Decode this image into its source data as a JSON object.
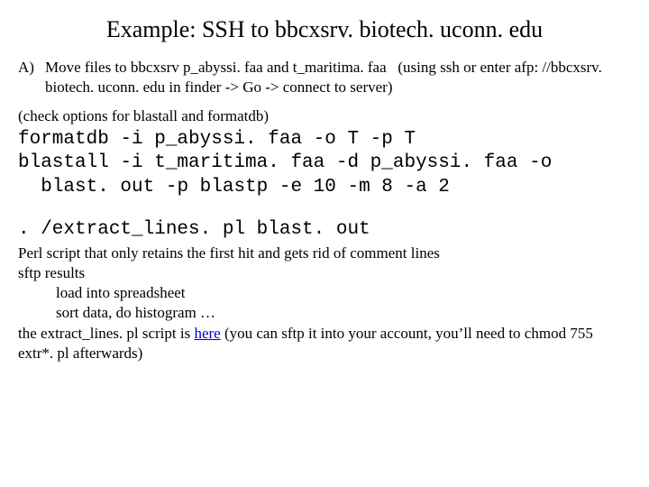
{
  "title": "Example: SSH to bbcxsrv. biotech. uconn. edu",
  "stepA": {
    "label": "A)",
    "text": "Move files to bbcxsrv p_abyssi. faa and t_maritima. faa   (using ssh or enter afp: //bbcxsrv. biotech. uconn. edu in finder -> Go -> connect to server)"
  },
  "checkNote": "(check options for blastall and formatdb)",
  "codeBlock": "formatdb -i p_abyssi. faa -o T -p T\nblastall -i t_maritima. faa -d p_abyssi. faa -o\n  blast. out -p blastp -e 10 -m 8 -a 2",
  "code2": ". /extract_lines. pl blast. out",
  "perlDesc": "Perl script that only retains the first hit and gets rid of comment lines",
  "sftp": "sftp results",
  "loadSheet": "load into spreadsheet",
  "sortData": "sort data, do histogram …",
  "scriptLine": {
    "pre": "the extract_lines. pl script is ",
    "link": "here",
    "post": " (you can sftp it into your account, you’ll need to chmod 755 extr*. pl afterwards)"
  }
}
